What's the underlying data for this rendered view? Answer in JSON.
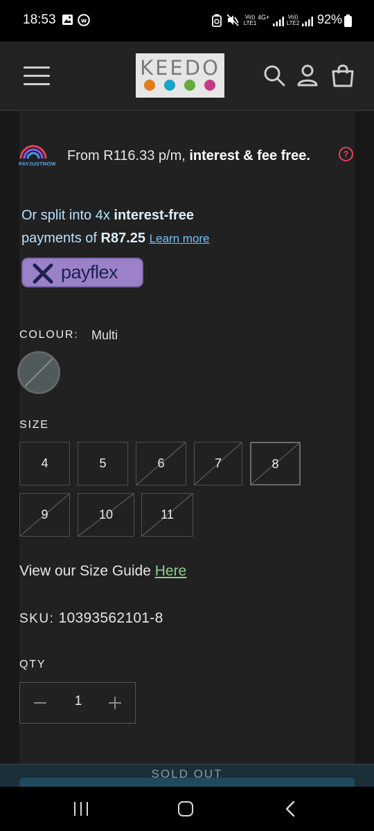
{
  "status_bar": {
    "time": "18:53",
    "battery": "92%",
    "network_labels": [
      "Vo)) LTE1",
      "4G+",
      "Vo)) LTE2"
    ],
    "icons": [
      "gallery-icon",
      "whatsapp-icon",
      "battery-saver-icon",
      "mute-icon",
      "signal-icon",
      "battery-icon"
    ]
  },
  "header": {
    "logo_text": "KEEDO",
    "logo_dot_colors": [
      "#e07b1e",
      "#1aa3c9",
      "#64a93a",
      "#c63a8a"
    ],
    "icons": [
      "menu-icon",
      "search-icon",
      "account-icon",
      "cart-icon"
    ]
  },
  "payjustnow": {
    "brand": "PAYJUSTNOW",
    "text_plain": "From R116.33 p/m, ",
    "text_bold": "interest & fee free.",
    "help_symbol": "?"
  },
  "payflex": {
    "line1_plain": "Or split into 4x ",
    "line1_bold": "interest-free",
    "line2_plain": "payments of ",
    "line2_bold": "R87.25",
    "learn_more": "Learn more",
    "logo_text": "payflex"
  },
  "colour": {
    "label": "COLOUR:",
    "value": "Multi"
  },
  "size": {
    "label": "SIZE",
    "options": [
      {
        "label": "4",
        "available": true,
        "selected": false
      },
      {
        "label": "5",
        "available": true,
        "selected": false
      },
      {
        "label": "6",
        "available": false,
        "selected": false
      },
      {
        "label": "7",
        "available": false,
        "selected": false
      },
      {
        "label": "8",
        "available": false,
        "selected": true
      },
      {
        "label": "9",
        "available": false,
        "selected": false
      },
      {
        "label": "10",
        "available": false,
        "selected": false
      },
      {
        "label": "11",
        "available": false,
        "selected": false
      }
    ]
  },
  "size_guide": {
    "text": "View our Size Guide ",
    "link": "Here"
  },
  "sku": {
    "label": "SKU:",
    "value": "10393562101-8"
  },
  "qty": {
    "label": "QTY",
    "value": "1"
  },
  "cta": {
    "label": "SOLD OUT"
  },
  "nav": {
    "icons": [
      "recent-apps-icon",
      "home-icon",
      "back-icon"
    ]
  }
}
